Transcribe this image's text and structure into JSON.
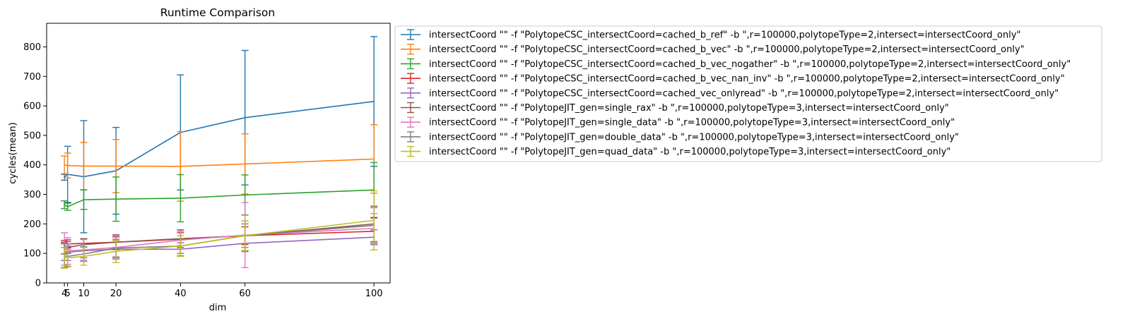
{
  "chart_data": {
    "type": "line",
    "title": "Runtime Comparison",
    "xlabel": "dim",
    "ylabel": "cycles(mean)",
    "xlim": [
      -1.5,
      105
    ],
    "ylim": [
      0,
      880
    ],
    "xticks": [
      4,
      5,
      10,
      20,
      40,
      60,
      100
    ],
    "yticks": [
      0,
      100,
      200,
      300,
      400,
      500,
      600,
      700,
      800
    ],
    "error_bars": true,
    "legend_position": "outside-right-top",
    "x": [
      4,
      5,
      10,
      20,
      40,
      60,
      100
    ],
    "series": [
      {
        "name": "intersectCoord \"\" -f \"PolytopeCSC_intersectCoord=cached_b_ref\" -b \",r=100000,polytopeType=2,intersect=intersectCoord_only\"",
        "color": "#1f77b4",
        "values": [
          358,
          368,
          360,
          380,
          510,
          560,
          615
        ],
        "errors": [
          10,
          95,
          190,
          147,
          195,
          228,
          220
        ]
      },
      {
        "name": "intersectCoord \"\" -f \"PolytopeCSC_intersectCoord=cached_b_vec\" -b \",r=100000,polytopeType=2,intersect=intersectCoord_only\"",
        "color": "#ff7f0e",
        "values": [
          400,
          398,
          396,
          396,
          395,
          403,
          420
        ],
        "errors": [
          30,
          42,
          80,
          90,
          118,
          102,
          116
        ]
      },
      {
        "name": "intersectCoord \"\" -f \"PolytopeCSC_intersectCoord=cached_b_vec_nogather\" -b \",r=100000,polytopeType=2,intersect=intersectCoord_only\"",
        "color": "#2ca02c",
        "values": [
          265,
          258,
          282,
          284,
          287,
          298,
          315
        ],
        "errors": [
          13,
          12,
          33,
          75,
          80,
          68,
          93
        ]
      },
      {
        "name": "intersectCoord \"\" -f \"PolytopeCSC_intersectCoord=cached_b_vec_nan_inv\" -b \",r=100000,polytopeType=2,intersect=intersectCoord_only\"",
        "color": "#d62728",
        "values": [
          132,
          132,
          134,
          138,
          148,
          160,
          175
        ],
        "errors": [
          12,
          14,
          14,
          18,
          22,
          30,
          45
        ]
      },
      {
        "name": "intersectCoord \"\" -f \"PolytopeCSC_intersectCoord=cached_vec_onlyread\" -b \",r=100000,polytopeType=2,intersect=intersectCoord_only\"",
        "color": "#9467bd",
        "values": [
          106,
          104,
          109,
          114,
          114,
          134,
          155
        ],
        "errors": [
          30,
          28,
          24,
          30,
          22,
          28,
          25
        ]
      },
      {
        "name": "intersectCoord \"\" -f \"PolytopeJIT_gen=single_rax\" -b \",r=100000,polytopeType=3,intersect=intersectCoord_only\"",
        "color": "#8c564b",
        "values": [
          118,
          120,
          130,
          138,
          150,
          160,
          200
        ],
        "errors": [
          20,
          20,
          20,
          25,
          30,
          50,
          60
        ]
      },
      {
        "name": "intersectCoord \"\" -f \"PolytopeJIT_gen=single_data\" -b \",r=100000,polytopeType=3,intersect=intersectCoord_only\"",
        "color": "#e377c2",
        "values": [
          115,
          108,
          112,
          120,
          145,
          162,
          185
        ],
        "errors": [
          55,
          45,
          35,
          40,
          30,
          110,
          50
        ]
      },
      {
        "name": "intersectCoord \"\" -f \"PolytopeJIT_gen=double_data\" -b \",r=100000,polytopeType=3,intersect=intersectCoord_only\"",
        "color": "#7f7f7f",
        "values": [
          92,
          90,
          98,
          118,
          125,
          160,
          195
        ],
        "errors": [
          40,
          35,
          25,
          30,
          25,
          40,
          60
        ]
      },
      {
        "name": "intersectCoord \"\" -f \"PolytopeJIT_gen=quad_data\" -b \",r=100000,polytopeType=3,intersect=intersectCoord_only\"",
        "color": "#bcbd22",
        "values": [
          85,
          85,
          90,
          107,
          125,
          160,
          212
        ],
        "errors": [
          35,
          28,
          30,
          38,
          35,
          50,
          100
        ]
      }
    ]
  }
}
